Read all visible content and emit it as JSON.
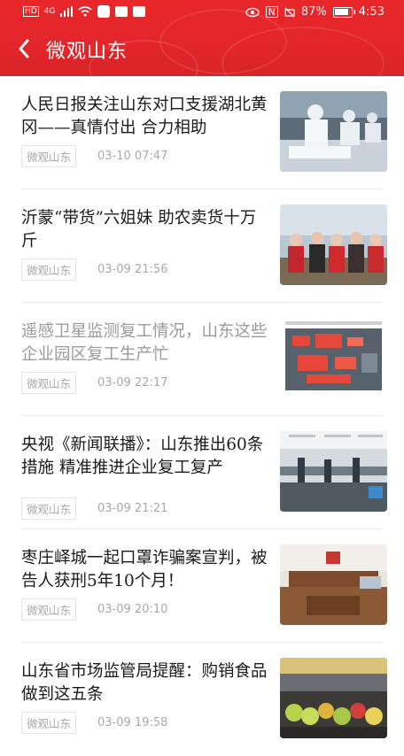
{
  "status_bar": {
    "left_icons": [
      "HD",
      "4G",
      "signal-icon",
      "wifi-icon",
      "app-icon-1",
      "app-icon-2",
      "app-icon-3"
    ],
    "battery": "87%",
    "battery_level": 0.87,
    "time": "4:53"
  },
  "header": {
    "title": "微观山东",
    "accent_color": "#e2262b"
  },
  "articles": [
    {
      "title": "人民日报关注山东对口支援湖北黄冈——真情付出 合力相助",
      "source": "微观山东",
      "time": "03-10 07:47",
      "read": false
    },
    {
      "title": "沂蒙“带货”六姐妹 助农卖货十万斤",
      "source": "微观山东",
      "time": "03-09 21:56",
      "read": false
    },
    {
      "title": "遥感卫星监测复工情况，山东这些企业园区复工生产忙",
      "source": "微观山东",
      "time": "03-09 22:17",
      "read": true
    },
    {
      "title": "央视《新闻联播》：山东推出60条措施 精准推进企业复工复产",
      "source": "微观山东",
      "time": "03-09 21:21",
      "read": false
    },
    {
      "title": "枣庄峄城一起口罩诈骗案宣判，被告人获刑5年10个月！",
      "source": "微观山东",
      "time": "03-09 20:10",
      "read": false
    },
    {
      "title": "山东省市场监管局提醒：购销食品做到这五条",
      "source": "微观山东",
      "time": "03-09 19:58",
      "read": false
    }
  ]
}
